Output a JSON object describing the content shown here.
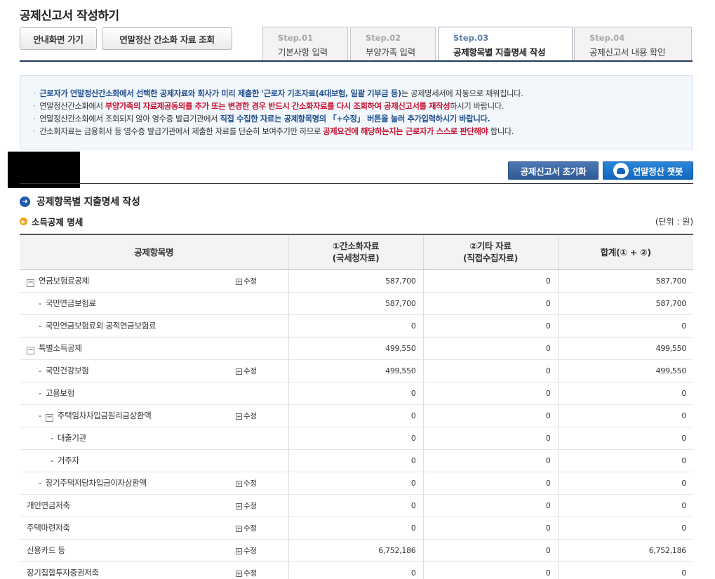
{
  "page_title": "공제신고서 작성하기",
  "top_buttons": {
    "guide": "안내화면 가기",
    "view": "연말정산 간소화 자료 조회"
  },
  "steps": [
    {
      "num": "Step.01",
      "label": "기본사항 입력"
    },
    {
      "num": "Step.02",
      "label": "부양가족 입력"
    },
    {
      "num": "Step.03",
      "label": "공제항목별 지출명세 작성"
    },
    {
      "num": "Step.04",
      "label": "공제신고서 내용 확인"
    }
  ],
  "notice": [
    {
      "a": "근로자가 연말정산간소화에서 선택한 공제자료와 회사가 미리 제출한 '근로자 기초자료(4대보험, 일괄 기부금 등)",
      "b": "는 공제명세서에 자동으로 채워집니다."
    },
    {
      "a": "연말정산간소화에서 ",
      "b": "부양가족의 자료제공동의를 추가 또는 변경한 경우 반드시 간소화자료를 다시 조회하여 공제신고서를 재작성",
      "c": "하시기 바랍니다."
    },
    {
      "a": "연말정산간소화에서 조회되지 않아 영수증 발급기관에서 ",
      "b": "직접 수집한 자료는 공제항목명의 「+수정」 버튼을 눌러 추가입력하시기 바랍니다."
    },
    {
      "a": "간소화자료는 금융회사 등 영수증 발급기관에서 제출한 자료를 단순히 보여주기만 하므로 ",
      "b": "공제요건에 해당하는지는 근로자가 스스로 판단해야",
      "c": " 합니다."
    }
  ],
  "actions": {
    "reset": "공제신고서 초기화",
    "chatbot": "연말정산 챗봇"
  },
  "section_title": "공제항목별 지출명세 작성",
  "sub_title": "소득공제 명세",
  "unit": "(단위 : 원)",
  "table": {
    "headers": {
      "name": "공제항목명",
      "col1": "①간소화자료",
      "col1b": "(국세청자료)",
      "col2": "②기타 자료",
      "col2b": "(직접수집자료)",
      "col3": "합계(① + ②)"
    },
    "edit_label": "수정",
    "rows": [
      {
        "name": "연금보험료공제",
        "toggle": "−",
        "edit": true,
        "v1": "587,700",
        "v2": "0",
        "v3": "587,700"
      },
      {
        "name": "국민연금보험료",
        "dash": "-",
        "v1": "587,700",
        "v2": "0",
        "v3": "587,700"
      },
      {
        "name": "국민연금보험료외 공적연금보험료",
        "dash": "-",
        "v1": "0",
        "v2": "0",
        "v3": "0"
      },
      {
        "name": "특별소득공제",
        "toggle": "−",
        "v1": "499,550",
        "v2": "0",
        "v3": "499,550"
      },
      {
        "name": "국민건강보험",
        "dash": "-",
        "edit": true,
        "v1": "499,550",
        "v2": "0",
        "v3": "499,550"
      },
      {
        "name": "고용보험",
        "dash": "-",
        "v1": "0",
        "v2": "0",
        "v3": "0"
      },
      {
        "name": "주택임차차입금원리금상환액",
        "dash": "-",
        "toggle": "−",
        "edit": true,
        "v1": "0",
        "v2": "0",
        "v3": "0"
      },
      {
        "name": "대출기관",
        "dash": "-",
        "v1": "0",
        "v2": "0",
        "v3": "0"
      },
      {
        "name": "거주자",
        "dash": "-",
        "v1": "0",
        "v2": "0",
        "v3": "0"
      },
      {
        "name": "장기주택저당차입금이자상환액",
        "dash": "-",
        "edit": true,
        "v1": "0",
        "v2": "0",
        "v3": "0"
      },
      {
        "name": "개인연금저축",
        "edit": true,
        "v1": "0",
        "v2": "0",
        "v3": "0"
      },
      {
        "name": "주택마련저축",
        "edit": true,
        "v1": "0",
        "v2": "0",
        "v3": "0"
      },
      {
        "name": "신용카드 등",
        "edit": true,
        "v1": "6,752,186",
        "v2": "0",
        "v3": "6,752,186"
      },
      {
        "name": "장기집합투자증권저축",
        "edit": true,
        "v1": "0",
        "v2": "0",
        "v3": "0"
      }
    ]
  }
}
